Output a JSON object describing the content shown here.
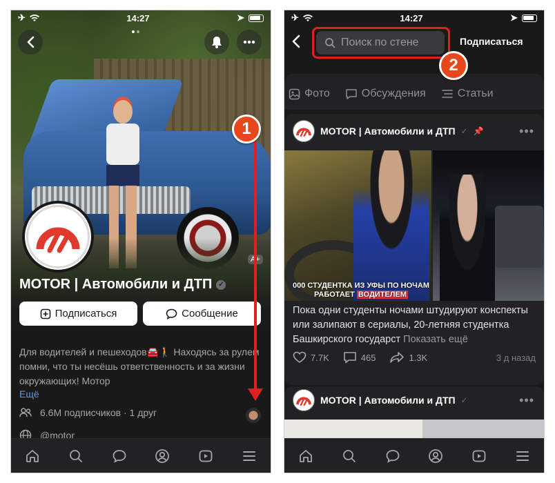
{
  "status_bar": {
    "time": "14:27"
  },
  "left": {
    "group_name": "MOTOR | Автомобили и ДТП",
    "aplus_badge": "A+",
    "buttons": {
      "subscribe": "Подписаться",
      "message": "Сообщение"
    },
    "description": "Для водителей и пешеходов🚘🚶 Находясь за рулем помни, что ты несёшь ответственность и за жизни окружающих! Мотор",
    "more_link": "Ещё",
    "subscribers": "6.6M подписчиков · 1 друг",
    "handle": "@motor",
    "step_badge": "1"
  },
  "right": {
    "search_placeholder": "Поиск по стене",
    "subscribe_label": "Подписаться",
    "step_badge": "2",
    "tabs": [
      {
        "label": "Фото",
        "icon": "photo-icon"
      },
      {
        "label": "Обсуждения",
        "icon": "discussion-icon"
      },
      {
        "label": "Статьи",
        "icon": "articles-icon"
      }
    ],
    "post1": {
      "author": "MOTOR | Автомобили и ДТП",
      "caption_line1": "000 СТУДЕНТКА ИЗ УФЫ ПО НОЧАМ",
      "caption_line2_a": "РАБОТАЕТ ",
      "caption_line2_b": "ВОДИТЕЛЕМ",
      "text": "Пока одни студенты ночами штудируют конспекты или залипают в сериалы, 20-летняя студентка Башкирского государст",
      "show_more": "Показать ещё",
      "likes": "7.7K",
      "comments": "465",
      "shares": "1.3K",
      "time": "3 д назад"
    },
    "post2": {
      "author": "MOTOR | Автомобили и ДТП"
    }
  },
  "accent_colors": {
    "annotation_red": "#e02020",
    "badge_orange": "#e8471b",
    "logo_red": "#e03a2f",
    "link_blue": "#5d9ae6"
  }
}
